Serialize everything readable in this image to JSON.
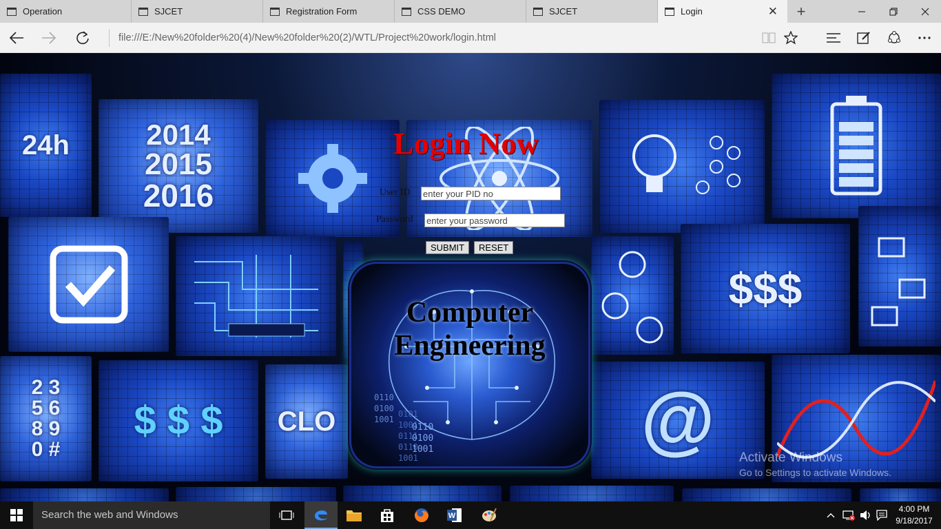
{
  "browser": {
    "tabs": [
      {
        "label": "Operation"
      },
      {
        "label": "SJCET"
      },
      {
        "label": "Registration Form"
      },
      {
        "label": "CSS DEMO"
      },
      {
        "label": "SJCET"
      },
      {
        "label": "Login"
      }
    ],
    "active_tab": "Login",
    "url": "file:///E:/New%20folder%20(4)/New%20folder%20(2)/WTL/Project%20work/login.html"
  },
  "page": {
    "title": "Login Now",
    "userid_label": "User ID",
    "userid_placeholder": "enter your PID no",
    "password_label": "Password",
    "password_placeholder": "enter your password",
    "submit_label": "SUBMIT",
    "reset_label": "RESET",
    "brain_title_line1": "Computer",
    "brain_title_line2": "Engineering",
    "binary_a": [
      "0110",
      "0100",
      "1001"
    ],
    "binary_b": [
      "0101",
      "1001",
      "0111",
      "0110",
      "1001"
    ],
    "binary_c": [
      "0110",
      "0100",
      "1001"
    ],
    "panels": {
      "clock24": "24h",
      "years": [
        "2014",
        "2015",
        "2016"
      ],
      "digits": [
        "2 3",
        "5 6",
        "8 9",
        "0 #"
      ],
      "cloud": "CLO"
    }
  },
  "watermark": {
    "line1": "Activate Windows",
    "line2": "Go to Settings to activate Windows."
  },
  "taskbar": {
    "search_placeholder": "Search the web and Windows",
    "time": "4:00 PM",
    "date": "9/18/2017"
  }
}
